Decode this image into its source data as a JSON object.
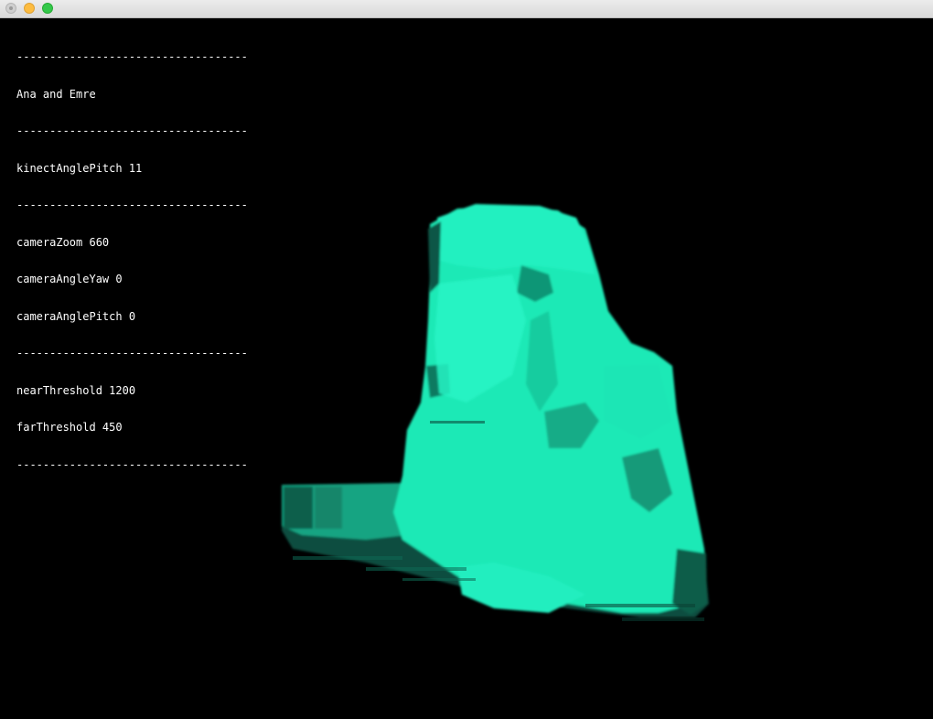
{
  "window": {
    "buttons": [
      "close",
      "minimize",
      "maximize"
    ]
  },
  "hud": {
    "separator": "-----------------------------------",
    "title": "Ana and Emre",
    "kinect_angle_pitch": "kinectAnglePitch 11",
    "camera_zoom": "cameraZoom 660",
    "camera_angle_yaw": "cameraAngleYaw 0",
    "camera_angle_pitch": "cameraAnglePitch 0",
    "near_threshold": "nearThreshold 1200",
    "far_threshold": "farThreshold 450"
  },
  "scene": {
    "point_cloud_color": "#1de9b6",
    "point_cloud_shadow_color": "#0b4d3f",
    "background_color": "#000000"
  }
}
